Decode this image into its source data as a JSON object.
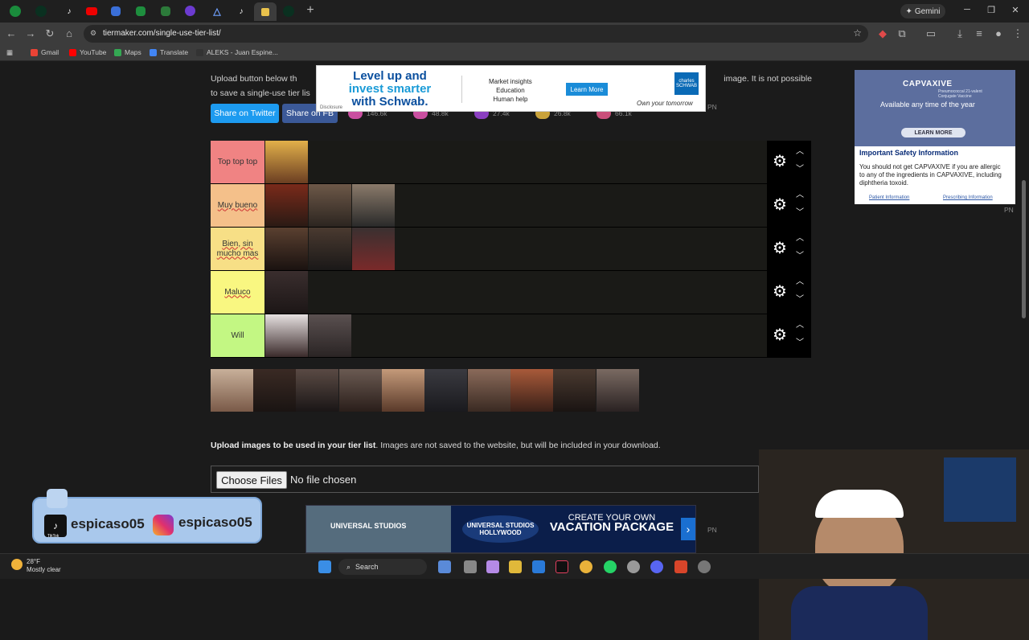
{
  "browser": {
    "url": "tiermaker.com/single-use-tier-list/",
    "gemini_label": "Gemini",
    "bookmarks": [
      "Gmail",
      "YouTube",
      "Maps",
      "Translate",
      "ALEKS - Juan Espine..."
    ]
  },
  "intro": {
    "text_start": "Upload button below th",
    "text_end": "image. It is not possible",
    "text_line2": "to save a single-use tier lis"
  },
  "share": {
    "twitter": "Share on Twitter",
    "facebook": "Share on FB",
    "reactions": [
      "146.6k",
      "48.8k",
      "27.4k",
      "26.8k",
      "66.1k"
    ]
  },
  "top_ad": {
    "headline1": "Level up and",
    "headline2": "invest smarter",
    "headline3": "with Schwab.",
    "mid1": "Market insights",
    "mid2": "Education",
    "mid3": "Human help",
    "cta": "Learn More",
    "brand": "charles SCHWAB",
    "tagline": "Own your tomorrow",
    "disclosure": "Disclosure"
  },
  "tiers": [
    {
      "label": "Top top top",
      "color": "#f08383"
    },
    {
      "label": "Muy bueno",
      "color": "#f4c08a"
    },
    {
      "label": "Bien, sin mucho mas",
      "color": "#f7df86"
    },
    {
      "label": "Maluco",
      "color": "#f9f781"
    },
    {
      "label": "Will",
      "color": "#c3f783"
    }
  ],
  "upload": {
    "bold": "Upload images to be used in your tier list",
    "rest": ". Images are not saved to the website, but will be included in your download.",
    "button": "Choose Files",
    "status": "No file chosen"
  },
  "side_ad": {
    "brand": "CAPVAXIVE",
    "small": "Pneumococcal 21-valent Conjugate Vaccine",
    "overlay": "Available any time of the year",
    "cta": "LEARN MORE",
    "isi_title": "Important Safety Information",
    "isi_text": "You should not get CAPVAXIVE if you are allergic to any of the ingredients in CAPVAXIVE, including diphtheria toxoid.",
    "link1": "Patient Information",
    "link2": "Prescribing Information"
  },
  "pn_label": "PN",
  "social": {
    "tiktok_handle": "espicaso05",
    "ig_handle": "espicaso05",
    "tiktok_label": "TikTok"
  },
  "bottom_ad": {
    "studio": "UNIVERSAL STUDIOS HOLLYWOOD",
    "line1": "CREATE YOUR OWN",
    "line2": "VACATION PACKAGE",
    "photo_text": "UNIVERSAL STUDIOS"
  },
  "taskbar": {
    "temp": "28°F",
    "condition": "Mostly clear",
    "search": "Search"
  }
}
